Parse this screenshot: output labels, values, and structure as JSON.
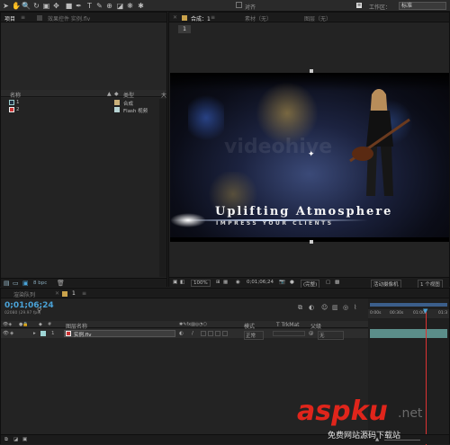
{
  "toolbar": {
    "snap_label": "对齐",
    "workspace_label": "工作区：",
    "workspace_value": "标准",
    "search_placeholder": ""
  },
  "project_panel": {
    "tab_label": "项目",
    "effects_tab_label": "效果控件 实例.flv",
    "search_placeholder": "",
    "col_name": "名称",
    "col_type": "类型",
    "col_size": "大",
    "items": [
      {
        "name": "1",
        "type": "合成"
      },
      {
        "name": "2",
        "type": "Flash 视频"
      }
    ],
    "bpc_label": "8 bpc"
  },
  "comp_panel": {
    "tab_comp": "合成：1",
    "tab_footage": "素材（无）",
    "tab_layer": "图层（无）",
    "comp_tab_number": "1"
  },
  "viewer": {
    "title_text": "Uplifting Atmosphere",
    "subtitle_text": "IMPRESS YOUR CLIENTS",
    "watermark_text": "videohive",
    "zoom": "100%",
    "timecode": "0;01;06;24",
    "resolution": "(完整)",
    "camera": "活动摄像机",
    "views": "1 个视图"
  },
  "timeline": {
    "tab_render": "渲染队列",
    "tab_comp": "1",
    "timecode": "0;01;06;24",
    "fps_label": "02080 (29.97 fps)",
    "col_layer_name": "图层名称",
    "col_mode": "模式",
    "col_trkmat": "T TrkMat",
    "col_parent": "父级",
    "layer": {
      "index": "1",
      "name": "实例.flv",
      "mode": "正常",
      "parent": "无"
    },
    "ruler_labels": [
      "0:00s",
      "00:30s",
      "01:00s",
      "01:3"
    ]
  },
  "watermark": {
    "brand": "aspku",
    "tld": ".net",
    "subtitle": "免费网站源码下载站"
  }
}
